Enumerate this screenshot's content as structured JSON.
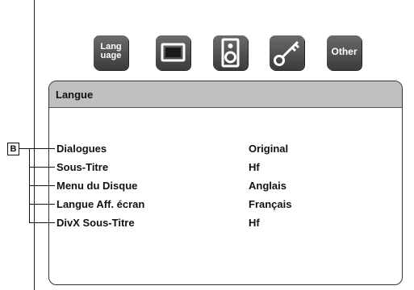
{
  "tabs": [
    {
      "id": "language",
      "label": "Lang\nuage"
    },
    {
      "id": "display",
      "label": ""
    },
    {
      "id": "audio",
      "label": ""
    },
    {
      "id": "lock",
      "label": ""
    },
    {
      "id": "other",
      "label": "Other"
    }
  ],
  "panel": {
    "title": "Langue",
    "items": [
      {
        "label": "Dialogues",
        "value": "Original"
      },
      {
        "label": "Sous-Titre",
        "value": "Hf"
      },
      {
        "label": "Menu du Disque",
        "value": "Anglais"
      },
      {
        "label": "Langue Aff. écran",
        "value": "Français"
      },
      {
        "label": "DivX Sous-Titre",
        "value": "Hf"
      }
    ]
  },
  "callout": {
    "label": "B"
  }
}
